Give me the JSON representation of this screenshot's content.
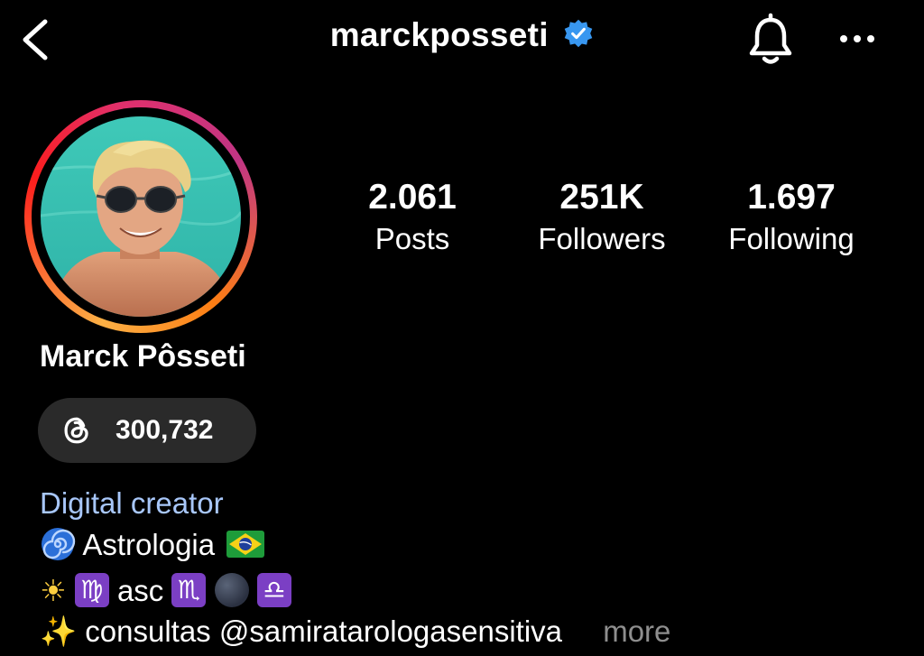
{
  "header": {
    "username": "marckposseti",
    "back_icon": "chevron-left-icon",
    "verified_icon": "verified-badge-icon",
    "bell_icon": "bell-icon",
    "more_icon": "more-horizontal-icon",
    "verified_color": "#3897f0"
  },
  "stats": [
    {
      "value": "2.061",
      "label": "Posts"
    },
    {
      "value": "251K",
      "label": "Followers"
    },
    {
      "value": "1.697",
      "label": "Following"
    }
  ],
  "profile": {
    "display_name": "Marck Pôsseti",
    "threads_count": "300,732",
    "threads_icon": "threads-icon"
  },
  "bio": {
    "category": "Digital creator",
    "line1_text": "Astrologia",
    "line2_text": "asc",
    "line3_text": "consultas",
    "mention": "@samiratarologasensitiva",
    "more": "more",
    "zodiac1": "♍",
    "zodiac2": "♏",
    "zodiac3": "♎",
    "sun": "☀",
    "sparkles": "✨"
  },
  "colors": {
    "category": "#a8c7fa",
    "pill_bg": "#2a2a2a",
    "zodiac_bg": "#7b3fc4",
    "more_link": "#8e8e8e"
  }
}
